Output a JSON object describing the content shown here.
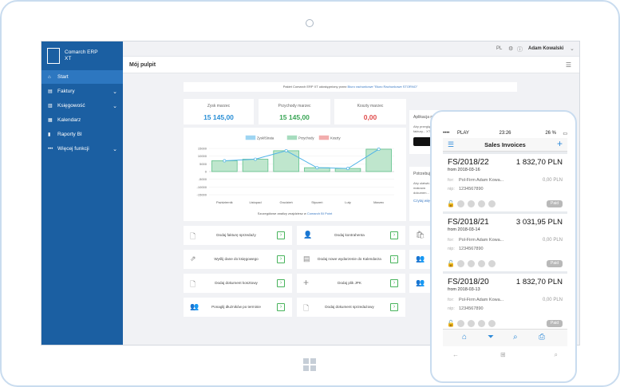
{
  "sidebar": {
    "logo_line1": "Comarch ERP",
    "logo_line2": "XT",
    "items": [
      {
        "label": "Start",
        "icon": "home-icon"
      },
      {
        "label": "Faktury",
        "icon": "invoice-icon"
      },
      {
        "label": "Księgowość",
        "icon": "book-icon"
      },
      {
        "label": "Kalendarz",
        "icon": "calendar-icon"
      },
      {
        "label": "Raporty BI",
        "icon": "report-icon"
      },
      {
        "label": "Więcej funkcji",
        "icon": "more-icon"
      }
    ]
  },
  "topbar": {
    "lang": "PL",
    "user": "Adam Kowalski"
  },
  "header": {
    "title": "Mój pulpit"
  },
  "notice": {
    "text": "Pakiet Comarch ERP XT udostępniony przez",
    "link": "Biuro rachunkowe \"Biuro Rachunkowe STORNO\""
  },
  "stats": [
    {
      "label": "Zysk marzec",
      "value": "15 145,00",
      "color": "#2a8fd6"
    },
    {
      "label": "Przychody marzec",
      "value": "15 145,00",
      "color": "#3aa656"
    },
    {
      "label": "Koszty marzec",
      "value": "0,00",
      "color": "#e04b4b"
    }
  ],
  "chart_data": {
    "type": "bar",
    "categories": [
      "Październik",
      "Listopad",
      "Grudzień",
      "Styczeń",
      "Luty",
      "Marzec"
    ],
    "series": [
      {
        "name": "Przychody",
        "values": [
          7000,
          8000,
          13500,
          2500,
          2000,
          14500
        ],
        "color": "#5ec08a"
      },
      {
        "name": "Koszty",
        "values": [
          0,
          0,
          0,
          0,
          0,
          0
        ],
        "color": "#e96b6b"
      },
      {
        "name": "Zysk/Strata",
        "values": [
          7000,
          8000,
          13500,
          2500,
          2000,
          14500
        ],
        "color": "#4fb3e8"
      }
    ],
    "yticks": [
      "15000",
      "10000",
      "5000",
      "0",
      "-5000",
      "-10000",
      "-15000"
    ],
    "ylim": [
      -15000,
      15000
    ],
    "footer_text": "Szczegółowe analizy znajdziesz w",
    "footer_link": "Comarch BI Point"
  },
  "side_cards": {
    "app_title": "Aplikacja mob",
    "app_text": "Aby przeglądać faktury... XT",
    "help_title": "Potrzebujesz",
    "help_text": "Aby ułatwić... makowa dokumen... ERP",
    "help_link": "Czytaj więcej"
  },
  "tiles": [
    {
      "label": "Dodaj fakturę sprzedaży",
      "icon": "document-icon"
    },
    {
      "label": "Dodaj kontrahenta",
      "icon": "contractor-icon"
    },
    {
      "label": "Wyślij dane do księgowego",
      "icon": "share-icon"
    },
    {
      "label": "Dodaj nowe wydarzenie do Kalendarza",
      "icon": "calendar-icon"
    },
    {
      "label": "Dodaj dokument kosztowy",
      "icon": "document-icon"
    },
    {
      "label": "Dodaj plik JPK",
      "icon": "plus-icon"
    },
    {
      "label": "Ponaglij dłużników po terminie",
      "icon": "users-icon"
    },
    {
      "label": "Dodaj dokument sprzedażowy",
      "icon": "document-icon"
    }
  ],
  "phone": {
    "carrier": "PLAY",
    "time": "23:26",
    "battery": "26 %",
    "title": "Sales Invoices",
    "for_label": "for:",
    "nip_label": "nip:",
    "invoices": [
      {
        "number": "FS/2018/22",
        "amount": "1 832,70 PLN",
        "date": "from 2018-03-16",
        "contractor": "Pol-Firm Adam Kowa...",
        "nip": "1234567890",
        "due": "0,00 PLN",
        "status": "Paid"
      },
      {
        "number": "FS/2018/21",
        "amount": "3 031,95 PLN",
        "date": "from 2018-03-14",
        "contractor": "Pol-Firm Adam Kowa...",
        "nip": "1234567890",
        "due": "0,00 PLN",
        "status": "Paid"
      },
      {
        "number": "FS/2018/20",
        "amount": "1 832,70 PLN",
        "date": "from 2018-03-13",
        "contractor": "Pol-Firm Adam Kowa...",
        "nip": "1234567890",
        "due": "0,00 PLN",
        "status": "Paid"
      }
    ]
  }
}
